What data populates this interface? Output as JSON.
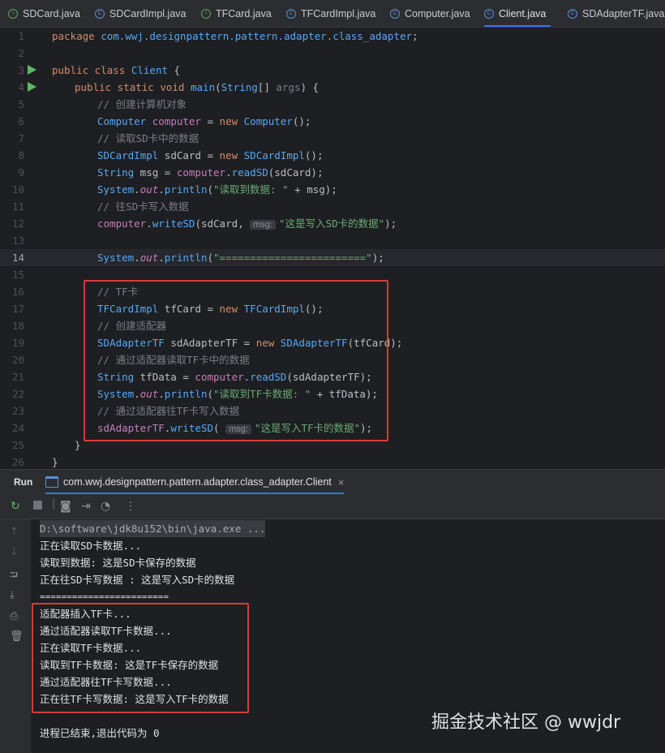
{
  "tabs": [
    {
      "label": "SDCard.java",
      "icon": "interface-icon"
    },
    {
      "label": "SDCardImpl.java",
      "icon": "class-icon"
    },
    {
      "label": "TFCard.java",
      "icon": "interface-icon"
    },
    {
      "label": "TFCardImpl.java",
      "icon": "class-icon"
    },
    {
      "label": "Computer.java",
      "icon": "class-icon"
    },
    {
      "label": "Client.java",
      "icon": "class-icon",
      "active": true
    },
    {
      "label": "SDAdapterTF.java",
      "icon": "class-icon"
    }
  ],
  "line_numbers": [
    "1",
    "2",
    "3",
    "4",
    "5",
    "6",
    "7",
    "8",
    "9",
    "10",
    "11",
    "12",
    "13",
    "14",
    "15",
    "16",
    "17",
    "18",
    "19",
    "20",
    "21",
    "22",
    "23",
    "24",
    "25",
    "26"
  ],
  "code": {
    "l1": [
      "package ",
      "com.wwj.designpattern.pattern.adapter.class_adapter",
      ";"
    ],
    "l3": [
      "public class ",
      "Client",
      " {"
    ],
    "l4": [
      "public static void ",
      "main",
      "(",
      "String",
      "[] ",
      "args",
      ") {"
    ],
    "l5": "// 创建计算机对象",
    "l6": [
      "Computer",
      " ",
      "computer",
      " = ",
      "new ",
      "Computer",
      "();"
    ],
    "l7": "// 读取SD卡中的数据",
    "l8": [
      "SDCardImpl",
      " sdCard = ",
      "new ",
      "SDCardImpl",
      "();"
    ],
    "l9": [
      "String",
      " msg = ",
      "computer",
      ".",
      "readSD",
      "(sdCard);"
    ],
    "l10": [
      "System",
      ".",
      "out",
      ".",
      "println",
      "(",
      "\"读取到数据: \"",
      " + msg);"
    ],
    "l11": "// 往SD卡写入数据",
    "l12": [
      "computer",
      ".",
      "writeSD",
      "(sdCard, ",
      "msg:",
      "\"这是写入SD卡的数据\"",
      ");"
    ],
    "l14": [
      "System",
      ".",
      "out",
      ".",
      "println",
      "(",
      "\"========================\"",
      ");"
    ],
    "l16": "// TF卡",
    "l17": [
      "TFCardImpl",
      " tfCard = ",
      "new ",
      "TFCardImpl",
      "();"
    ],
    "l18": "// 创建适配器",
    "l19": [
      "SDAdapterTF",
      " sdAdapterTF = ",
      "new ",
      "SDAdapterTF",
      "(tfCard);"
    ],
    "l20": "// 通过适配器读取TF卡中的数据",
    "l21": [
      "String",
      " tfData = ",
      "computer",
      ".",
      "readSD",
      "(sdAdapterTF);"
    ],
    "l22": [
      "System",
      ".",
      "out",
      ".",
      "println",
      "(",
      "\"读取到TF卡数据: \"",
      " + tfData);"
    ],
    "l23": "// 通过适配器往TF卡写入数据",
    "l24": [
      "sdAdapterTF",
      ".",
      "writeSD",
      "( ",
      "msg:",
      "\"这是写入TF卡的数据\"",
      ");"
    ],
    "l25": "}",
    "l26": "}"
  },
  "run_panel": {
    "label": "Run",
    "tab_title": "com.wwj.designpattern.pattern.adapter.class_adapter.Client",
    "close": "×"
  },
  "console_lines": [
    "D:\\software\\jdk8u152\\bin\\java.exe ...",
    "正在读取SD卡数据...",
    "读取到数据: 这是SD卡保存的数据",
    "正在往SD卡写数据 : 这是写入SD卡的数据",
    "========================",
    "适配器插入TF卡...",
    "通过适配器读取TF卡数据...",
    "正在读取TF卡数据...",
    "读取到TF卡数据: 这是TF卡保存的数据",
    "通过适配器往TF卡写数据...",
    "正在往TF卡写数据: 这是写入TF卡的数据",
    "",
    "进程已结束,退出代码为 0"
  ],
  "watermark": "掘金技术社区 @ wwjdr",
  "colors": {
    "highlight_box": "#d63c3c",
    "accent": "#3574f0",
    "run_icon": "#5fb865"
  }
}
